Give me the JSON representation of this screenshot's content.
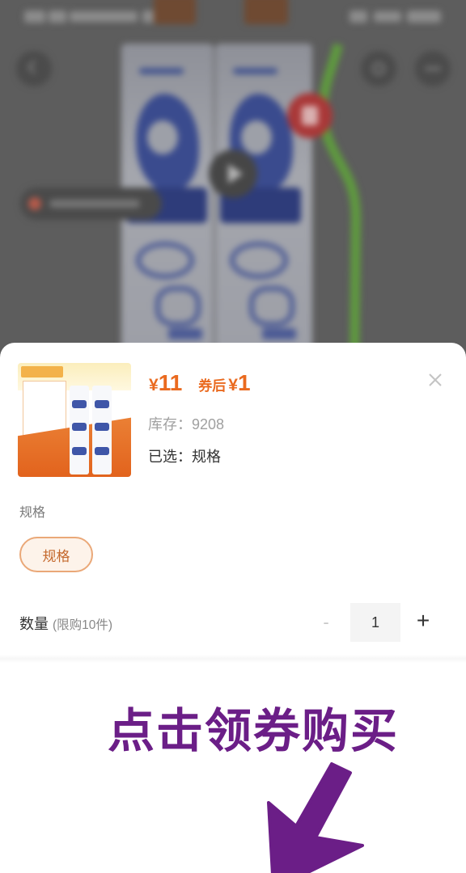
{
  "product": {
    "price_symbol": "¥",
    "price": "11",
    "coupon_label": "券后",
    "coupon_price_symbol": "¥",
    "coupon_price": "1",
    "stock_label": "库存：",
    "stock_value": "9208",
    "selected_label": "已选：",
    "selected_value": "规格"
  },
  "spec": {
    "title": "规格",
    "options": [
      {
        "label": "规格",
        "selected": true
      }
    ]
  },
  "quantity": {
    "label": "数量",
    "limit_note": "(限购10件)",
    "value": "1",
    "minus_symbol": "-",
    "plus_symbol": "+"
  },
  "annotation": {
    "text": "点击领券购买"
  },
  "icons": {
    "back": "back-icon",
    "share": "share-icon",
    "more": "more-icon",
    "play": "play-icon",
    "close": "close-icon",
    "arrow": "arrow-down-left-icon"
  },
  "colors": {
    "price": "#ea6a1f",
    "spec_border": "#eaa878",
    "spec_background": "#fdf3ea",
    "annotation": "#6b1e87",
    "mask": "#5d5d5d"
  }
}
